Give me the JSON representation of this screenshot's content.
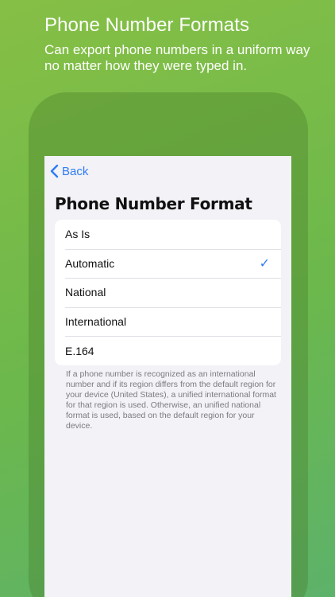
{
  "promo": {
    "headline": "Phone Number Formats",
    "subline": "Can export phone numbers in a uniform way no matter how they were typed in."
  },
  "nav": {
    "back_label": "Back",
    "back_icon": "chevron-left-icon"
  },
  "page": {
    "title": "Phone Number Format"
  },
  "options": [
    {
      "label": "As Is",
      "selected": false
    },
    {
      "label": "Automatic",
      "selected": true
    },
    {
      "label": "National",
      "selected": false
    },
    {
      "label": "International",
      "selected": false
    },
    {
      "label": "E.164",
      "selected": false
    }
  ],
  "check_glyph": "✓",
  "footnote": "If a phone number is recognized as an international number and if its region differs from the default region for your device (United States), a unified international format for that region is used. Otherwise, an unified national format is used, based on the default region for your device.",
  "colors": {
    "accent": "#2f7bf5",
    "background_green": "#79bb4a"
  }
}
